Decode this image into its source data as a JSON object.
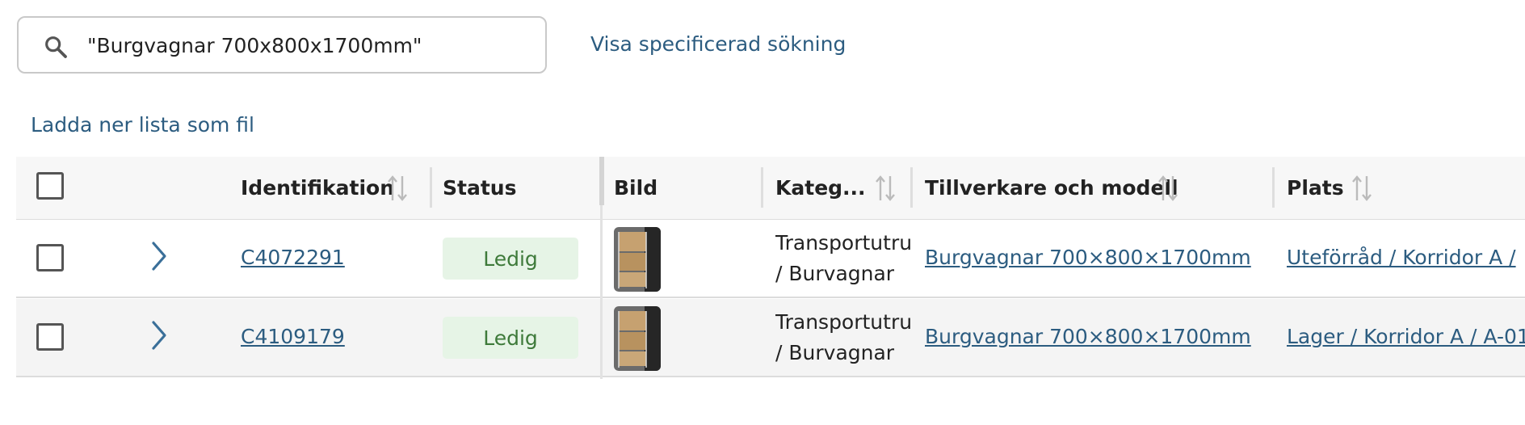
{
  "search": {
    "value": "\"Burgvagnar 700x800x1700mm\"",
    "advanced_link": "Visa specificerad sökning"
  },
  "download_link": "Ladda ner lista som fil",
  "table": {
    "columns": {
      "identifikation": "Identifikation",
      "status": "Status",
      "bild": "Bild",
      "kategori": "Kateg...",
      "tillverkare": "Tillverkare och modell",
      "plats": "Plats"
    },
    "rows": [
      {
        "id": "C4072291",
        "status": "Ledig",
        "category_line1": "Transportutru",
        "category_line2": "/ Burvagnar",
        "model": "Burgvagnar 700×800×1700mm",
        "location": "Uteförråd / Korridor A /"
      },
      {
        "id": "C4109179",
        "status": "Ledig",
        "category_line1": "Transportutru",
        "category_line2": "/ Burvagnar",
        "model": "Burgvagnar 700×800×1700mm",
        "location": "Lager / Korridor A / A-01"
      }
    ]
  },
  "colors": {
    "link": "#2c5c80",
    "badge_bg": "#e6f4e6",
    "badge_text": "#3e7a3a",
    "header_bg": "#f7f7f7",
    "alt_row_bg": "#f4f4f4"
  },
  "icons": {
    "search": "search-icon",
    "sort": "sort-icon",
    "expand": "chevron-right-icon"
  }
}
